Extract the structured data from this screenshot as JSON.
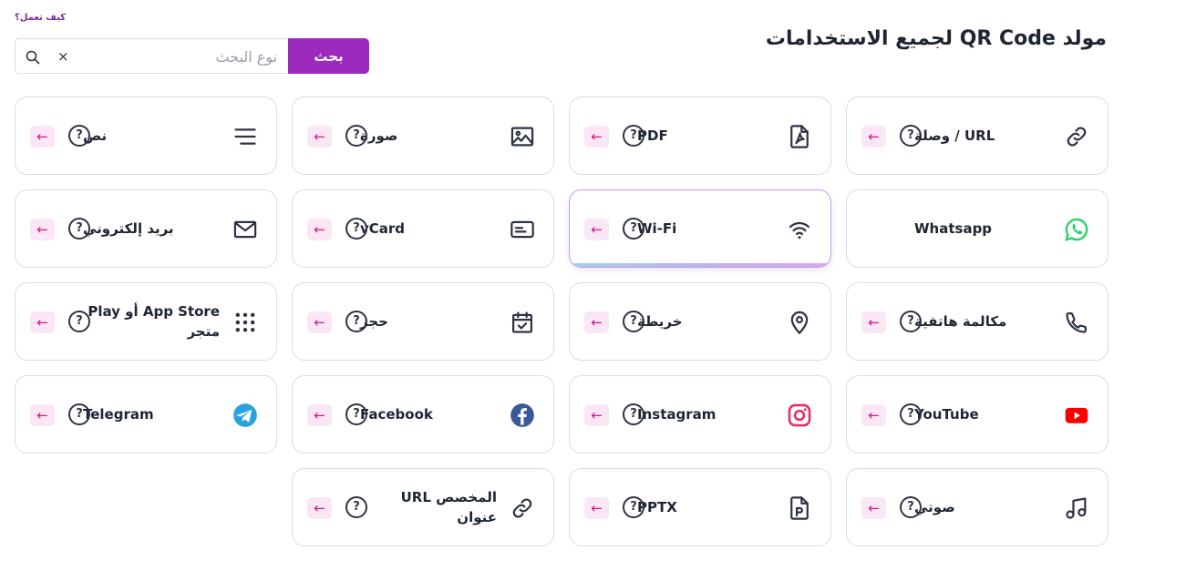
{
  "header": {
    "how_it_works": "كيف تعمل؟",
    "title": "مولد QR Code لجميع الاستخدامات"
  },
  "search": {
    "placeholder": "نوع البحث",
    "value": "",
    "button_label": "بحث",
    "clear_symbol": "×"
  },
  "card_controls": {
    "help_symbol": "?",
    "arrow_symbol": "←"
  },
  "colors": {
    "accent": "#9c2bbd",
    "arrow_bg": "#fbe6f6",
    "arrow_fg": "#d0188a",
    "whatsapp": "#25d366",
    "youtube": "#ff0000",
    "facebook": "#3b5998",
    "telegram": "#2aa3dc",
    "instagram": "#e1306c"
  },
  "cards": [
    {
      "id": "url",
      "label": "URL / وصلة",
      "icon": "link-icon",
      "has_controls": true
    },
    {
      "id": "pdf",
      "label": "PDF",
      "icon": "pdf-file-icon",
      "has_controls": true
    },
    {
      "id": "image",
      "label": "صورة",
      "icon": "image-icon",
      "has_controls": true
    },
    {
      "id": "text",
      "label": "نص",
      "icon": "text-lines-icon",
      "has_controls": true
    },
    {
      "id": "whatsapp",
      "label": "Whatsapp",
      "icon": "whatsapp-icon",
      "has_controls": false
    },
    {
      "id": "wifi",
      "label": "Wi-Fi",
      "icon": "wifi-icon",
      "has_controls": true,
      "active": true
    },
    {
      "id": "vcard",
      "label": "vCard",
      "icon": "vcard-icon",
      "has_controls": true
    },
    {
      "id": "email",
      "label": "بريد إلكتروني",
      "icon": "envelope-icon",
      "has_controls": true
    },
    {
      "id": "phone",
      "label": "مكالمة هاتفية",
      "icon": "phone-icon",
      "has_controls": true
    },
    {
      "id": "map",
      "label": "خريطة",
      "icon": "map-pin-icon",
      "has_controls": true
    },
    {
      "id": "booking",
      "label": "حجز",
      "icon": "calendar-check-icon",
      "has_controls": true
    },
    {
      "id": "appstore",
      "label": "App Store أو Play متجر",
      "icon": "apps-grid-icon",
      "has_controls": true
    },
    {
      "id": "youtube",
      "label": "YouTube",
      "icon": "youtube-icon",
      "has_controls": true
    },
    {
      "id": "instagram",
      "label": "Instagram",
      "icon": "instagram-icon",
      "has_controls": true
    },
    {
      "id": "facebook",
      "label": "Facebook",
      "icon": "facebook-icon",
      "has_controls": true
    },
    {
      "id": "telegram",
      "label": "Telegram",
      "icon": "telegram-icon",
      "has_controls": true
    },
    {
      "id": "audio",
      "label": "صوتي",
      "icon": "music-note-icon",
      "has_controls": true
    },
    {
      "id": "pptx",
      "label": "PPTX",
      "icon": "pptx-file-icon",
      "has_controls": true
    },
    {
      "id": "custom-url",
      "label": "المخصص URL عنوان",
      "icon": "link-icon",
      "has_controls": true
    }
  ]
}
